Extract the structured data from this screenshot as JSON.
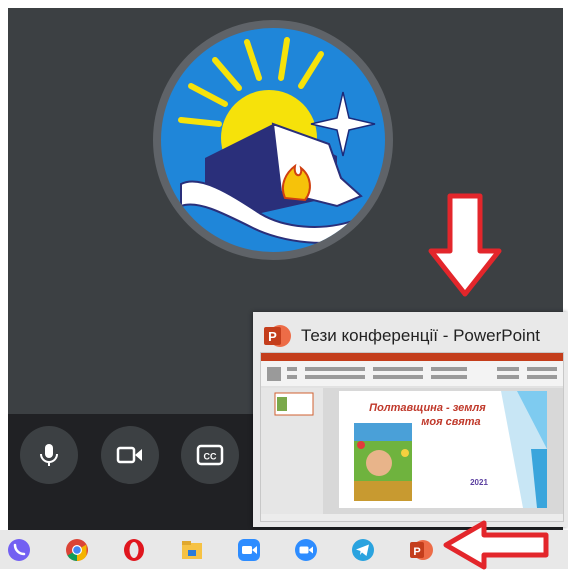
{
  "window": {
    "title": "Тези конференції - PowerPoint"
  },
  "slide": {
    "title": "Полтавщина - земля моя свята",
    "year": "2021"
  },
  "controls": {
    "mic": "microphone-icon",
    "camera": "camera-icon",
    "captions": "captions-icon"
  },
  "taskbar": {
    "apps": [
      "viber",
      "chrome",
      "opera",
      "file-explorer",
      "zoom",
      "zoom",
      "telegram",
      "powerpoint"
    ]
  },
  "colors": {
    "meeting_bg": "#3c4043",
    "controls_bg": "#202124",
    "arrow_red": "#e3262b",
    "ppt_orange": "#c43e1c"
  }
}
